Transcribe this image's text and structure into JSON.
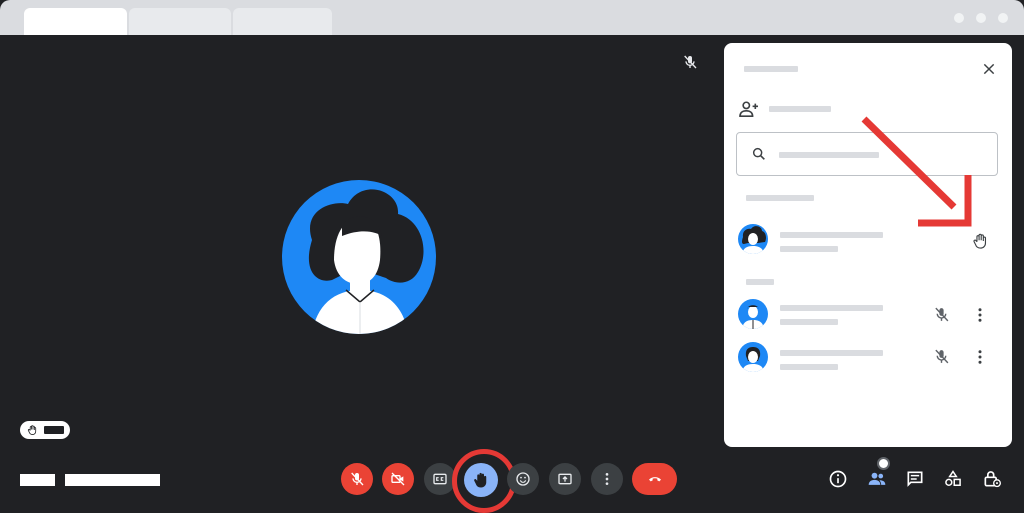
{
  "window": {
    "tabs": [
      "",
      "",
      ""
    ]
  },
  "icons": {
    "corner_mic": "mic-off-icon",
    "add_person": "person-add-icon",
    "search": "search-icon",
    "close": "close-icon",
    "raised_hand": "hand-icon",
    "mic_off": "mic-off-icon",
    "more": "more-vert-icon"
  },
  "controls": {
    "mic": "mic-off-icon",
    "camera": "videocam-off-icon",
    "captions": "closed-caption-icon",
    "raise_hand": "hand-icon",
    "reactions": "emoji-icon",
    "present": "present-screen-icon",
    "more": "more-vert-icon",
    "end_call": "call-end-icon"
  },
  "right_controls": [
    "info-icon",
    "people-icon",
    "chat-icon",
    "activities-icon",
    "host-controls-icon"
  ],
  "colors": {
    "accent_blue": "#8ab4f8",
    "avatar_blue": "#1e88f5",
    "end_red": "#ea4335",
    "highlight_red": "#e53935"
  },
  "participants": {
    "raised": [
      {
        "state": "hand-raised"
      }
    ],
    "others": [
      {
        "state": "muted"
      },
      {
        "state": "muted"
      }
    ]
  }
}
